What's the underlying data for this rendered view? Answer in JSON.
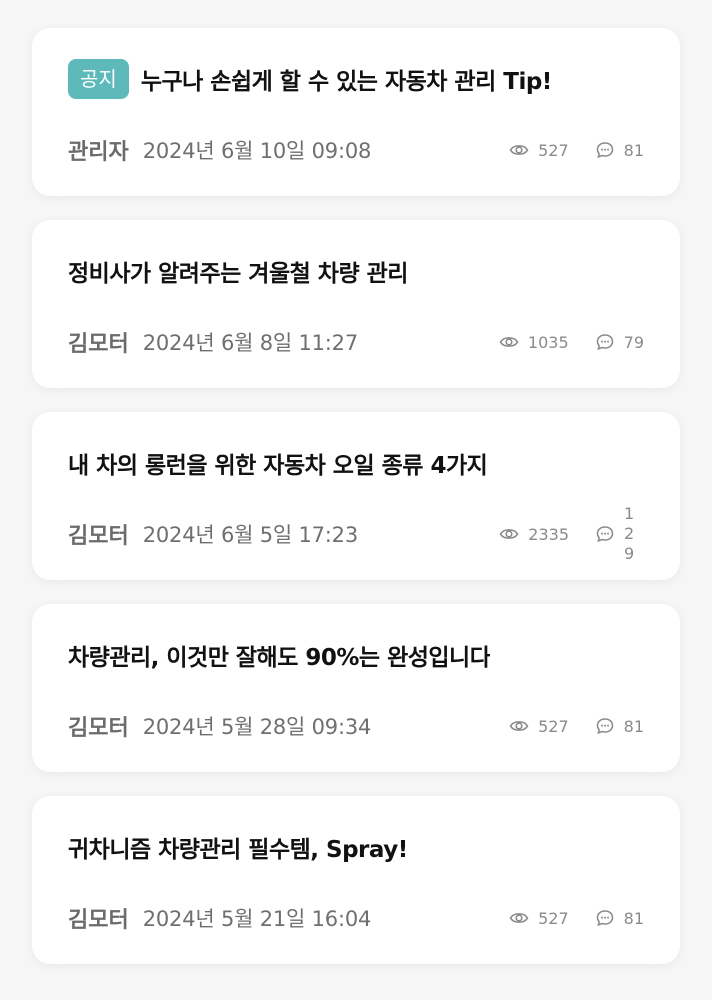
{
  "posts": [
    {
      "badge": "공지",
      "title": "누구나 손쉽게 할 수 있는 자동차 관리 Tip!",
      "author": "관리자",
      "date": "2024년 6월 10일 09:08",
      "views": "527",
      "comments": "81"
    },
    {
      "title": "정비사가 알려주는 겨울철 차량 관리",
      "author": "김모터",
      "date": "2024년 6월 8일 11:27",
      "views": "1035",
      "comments": "79"
    },
    {
      "title": "내 차의 롱런을 위한 자동차 오일 종류 4가지",
      "author": "김모터",
      "date": "2024년 6월 5일 17:23",
      "views": "2335",
      "comments": "129"
    },
    {
      "title": "차량관리, 이것만 잘해도 90%는 완성입니다",
      "author": "김모터",
      "date": "2024년 5월 28일 09:34",
      "views": "527",
      "comments": "81"
    },
    {
      "title": "귀차니즘 차량관리 필수템, Spray!",
      "author": "김모터",
      "date": "2024년 5월 21일 16:04",
      "views": "527",
      "comments": "81"
    }
  ],
  "icons": {
    "views": "eye-icon",
    "comments": "comment-bubble-icon"
  },
  "colors": {
    "badge_bg": "#5db9ba",
    "card_bg": "#ffffff",
    "page_bg": "#f6f6f7",
    "title": "#111111",
    "meta": "#6f6f6f"
  }
}
